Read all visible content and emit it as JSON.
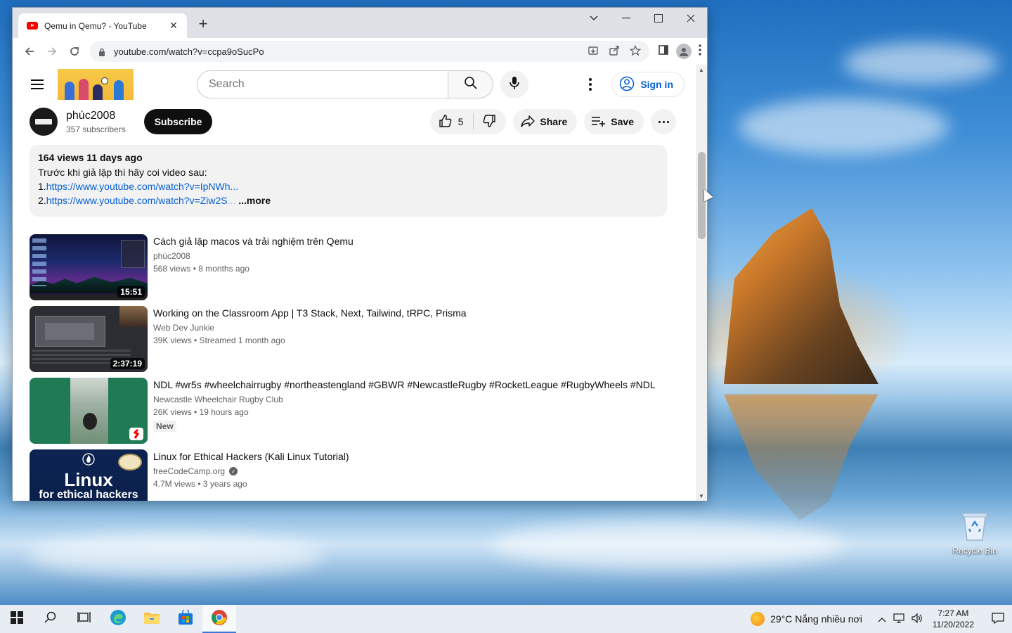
{
  "browser": {
    "tab_title": "Qemu in Qemu? - YouTube",
    "url": "youtube.com/watch?v=ccpa9oSucPo"
  },
  "youtube": {
    "search_placeholder": "Search",
    "sign_in_label": "Sign in",
    "channel": {
      "name": "phúc2008",
      "subscribers": "357 subscribers",
      "subscribe_label": "Subscribe"
    },
    "actions": {
      "like_count": "5",
      "share_label": "Share",
      "save_label": "Save"
    },
    "description": {
      "meta": "164 views  11 days ago",
      "line1": "Trước khi giả lập thì hãy coi video sau:",
      "link1_prefix": "1.",
      "link1": "https://www.youtube.com/watch?v=IpNWh...",
      "link2_prefix": "2.",
      "link2": "https://www.youtube.com/watch?v=Ziw2S",
      "link2_fade": "...",
      "more_label": "...more"
    },
    "recommendations": [
      {
        "title": "Cách giả lập macos và trải nghiệm trên Qemu",
        "channel": "phúc2008",
        "meta": "568 views  • 8 months ago",
        "duration": "15:51"
      },
      {
        "title": "Working on the Classroom App | T3 Stack, Next, Tailwind, tRPC, Prisma",
        "channel": "Web Dev Junkie",
        "meta": "39K views  • Streamed 1 month ago",
        "duration": "2:37:19"
      },
      {
        "title": "NDL #wr5s #wheelchairrugby #northeastengland #GBWR #NewcastleRugby #RocketLeague #RugbyWheels #NDL",
        "channel": "Newcastle Wheelchair Rugby Club",
        "meta": "26K views  • 19 hours ago",
        "badge": "New"
      },
      {
        "title": "Linux for Ethical Hackers (Kali Linux Tutorial)",
        "channel": "freeCodeCamp.org",
        "meta": "4.7M views  • 3 years ago",
        "thumb_text_1": "Linux",
        "thumb_text_2": "for ethical hackers"
      }
    ]
  },
  "desktop": {
    "recycle_bin_label": "Recycle Bin"
  },
  "taskbar": {
    "weather": "29°C  Nắng nhiều nơi",
    "time": "7:27 AM",
    "date": "11/20/2022"
  }
}
